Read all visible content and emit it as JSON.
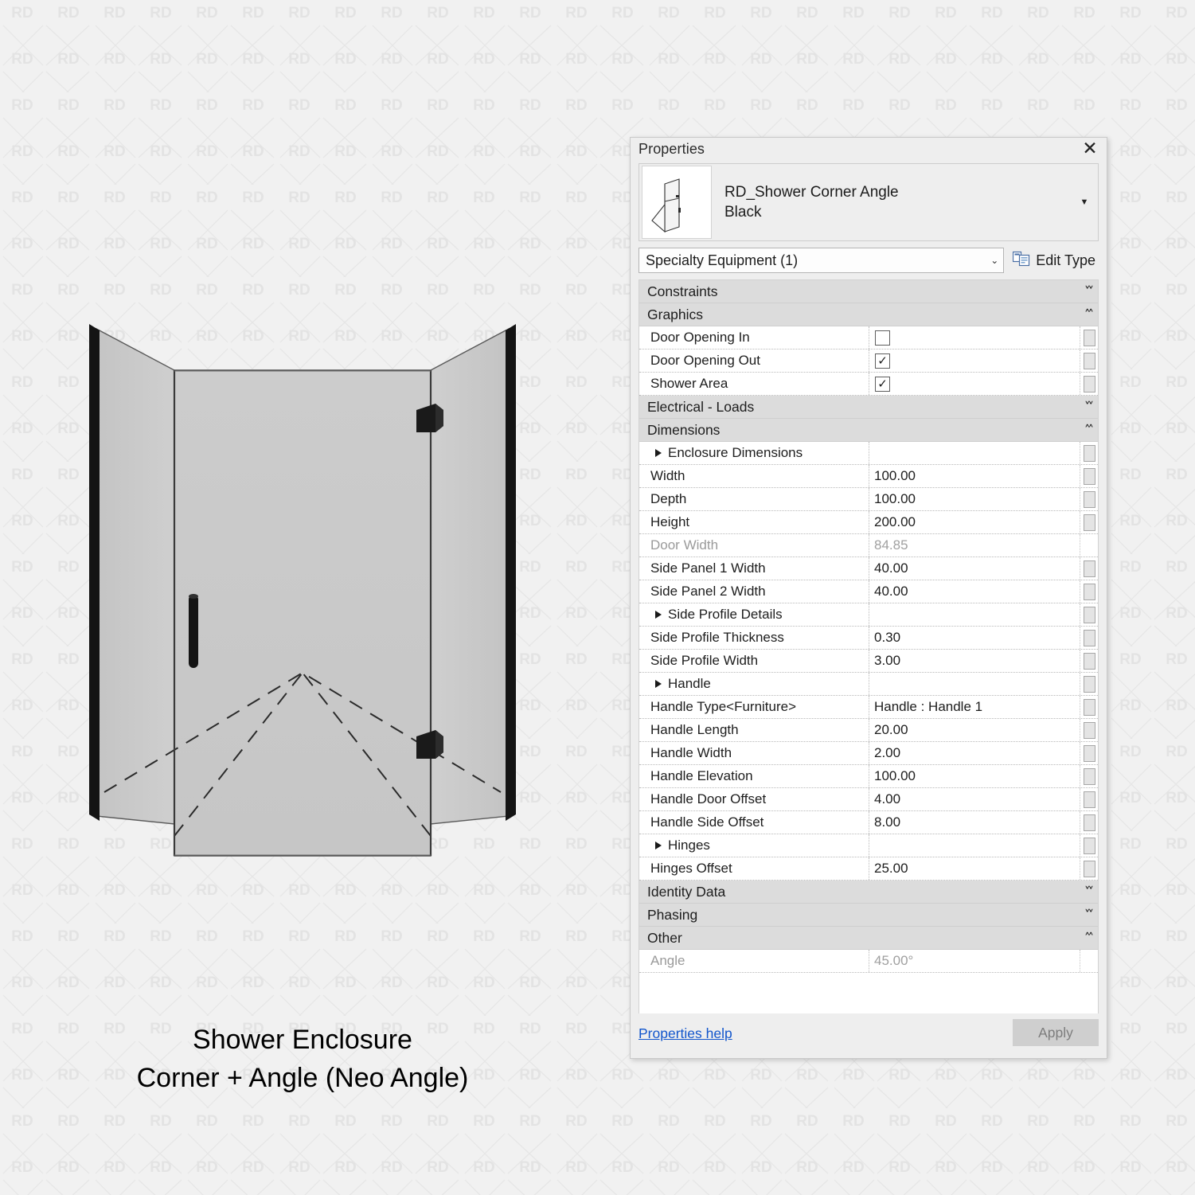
{
  "background": {
    "watermark_text": "RD",
    "bg_color": "#f1f1f1",
    "watermark_color": "#e3e3e3"
  },
  "illustration": {
    "name": "shower-enclosure-3d-view",
    "caption_line1": "Shower Enclosure",
    "caption_line2": "Corner + Angle (Neo Angle)",
    "glass_color": "#c9c9c9",
    "frame_color": "#151515"
  },
  "properties_panel": {
    "title": "Properties",
    "close_label": "✕",
    "type_name_line1": "RD_Shower Corner Angle",
    "type_name_line2": "Black",
    "type_dropdown_arrow": "▼",
    "family_selector_value": "Specialty Equipment (1)",
    "family_selector_chevron": "⌄",
    "edit_type_label": "Edit Type",
    "help_link": "Properties help",
    "apply_label": "Apply",
    "collapse_glyph": "«",
    "expand_glyph": "»",
    "checked_glyph": "✓",
    "rows": [
      {
        "kind": "section",
        "label": "Constraints",
        "state": "collapsed"
      },
      {
        "kind": "section",
        "label": "Graphics",
        "state": "expanded"
      },
      {
        "kind": "prop",
        "name": "Door Opening In",
        "type": "checkbox",
        "checked": false
      },
      {
        "kind": "prop",
        "name": "Door Opening Out",
        "type": "checkbox",
        "checked": true
      },
      {
        "kind": "prop",
        "name": "Shower Area",
        "type": "checkbox",
        "checked": true
      },
      {
        "kind": "section",
        "label": "Electrical - Loads",
        "state": "collapsed"
      },
      {
        "kind": "section",
        "label": "Dimensions",
        "state": "expanded"
      },
      {
        "kind": "group",
        "name": "Enclosure Dimensions"
      },
      {
        "kind": "prop",
        "name": "Width",
        "value": "100.00"
      },
      {
        "kind": "prop",
        "name": "Depth",
        "value": "100.00"
      },
      {
        "kind": "prop",
        "name": "Height",
        "value": "200.00"
      },
      {
        "kind": "prop",
        "name": "Door Width",
        "value": "84.85",
        "disabled": true
      },
      {
        "kind": "prop",
        "name": "Side Panel 1 Width",
        "value": "40.00"
      },
      {
        "kind": "prop",
        "name": "Side Panel 2 Width",
        "value": "40.00"
      },
      {
        "kind": "group",
        "name": "Side Profile Details"
      },
      {
        "kind": "prop",
        "name": "Side Profile Thickness",
        "value": "0.30"
      },
      {
        "kind": "prop",
        "name": "Side Profile Width",
        "value": "3.00"
      },
      {
        "kind": "group",
        "name": "Handle"
      },
      {
        "kind": "prop",
        "name": "Handle Type<Furniture>",
        "value": "Handle : Handle 1"
      },
      {
        "kind": "prop",
        "name": "Handle Length",
        "value": "20.00"
      },
      {
        "kind": "prop",
        "name": "Handle Width",
        "value": "2.00"
      },
      {
        "kind": "prop",
        "name": "Handle Elevation",
        "value": "100.00"
      },
      {
        "kind": "prop",
        "name": "Handle Door Offset",
        "value": "4.00"
      },
      {
        "kind": "prop",
        "name": "Handle Side Offset",
        "value": "8.00"
      },
      {
        "kind": "group",
        "name": "Hinges"
      },
      {
        "kind": "prop",
        "name": "Hinges Offset",
        "value": "25.00"
      },
      {
        "kind": "section",
        "label": "Identity Data",
        "state": "collapsed"
      },
      {
        "kind": "section",
        "label": "Phasing",
        "state": "collapsed"
      },
      {
        "kind": "section",
        "label": "Other",
        "state": "expanded"
      },
      {
        "kind": "prop",
        "name": "Angle",
        "value": "45.00°",
        "disabled": true,
        "noassoc": true
      }
    ]
  }
}
